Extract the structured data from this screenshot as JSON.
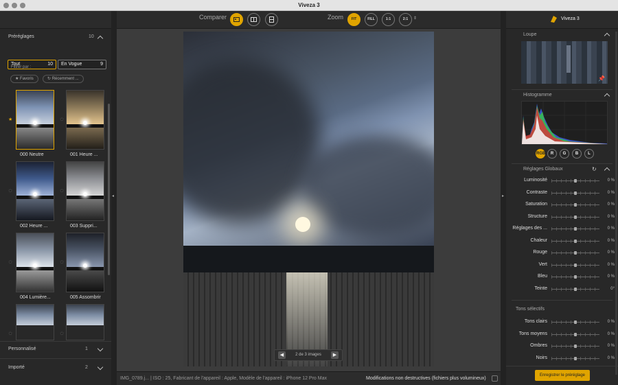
{
  "window": {
    "title": "Viveza 3"
  },
  "left_panel": {
    "presets_title": "Préréglages",
    "presets_count": "10",
    "tabs": [
      {
        "label": "Tout",
        "count": "10"
      },
      {
        "label": "En Vogue",
        "count": "9"
      }
    ],
    "filter_label": "Filtrer par :",
    "filters": [
      "★ Favoris",
      "↻ Récemment ..."
    ],
    "thumbnails": [
      {
        "label": "000 Neutre",
        "favorite": true
      },
      {
        "label": "001 Heure ...",
        "favorite": false
      },
      {
        "label": "002 Heure ...",
        "favorite": false
      },
      {
        "label": "003 Suppri...",
        "favorite": false
      },
      {
        "label": "004 Lumière...",
        "favorite": false
      },
      {
        "label": "005 Assombrir",
        "favorite": false
      },
      {
        "label": "",
        "favorite": false
      },
      {
        "label": "",
        "favorite": false
      }
    ],
    "personalise": {
      "label": "Personnalisé",
      "count": "1"
    },
    "importe": {
      "label": "Importé",
      "count": "2"
    }
  },
  "toolbar": {
    "compare_label": "Comparer",
    "zoom_label": "Zoom",
    "zoom_options": [
      "FIT",
      "FILL",
      "1:1",
      "2:1"
    ],
    "zoom_selected": "FIT"
  },
  "image_nav": {
    "text": "2 de 3 images",
    "prev": "◀",
    "next": "▶"
  },
  "status": {
    "info": "IMG_0789.j...    |    ISO : 25, Fabricant de l'appareil : Apple, Modèle de l'appareil : iPhone 12 Pro Max",
    "nondestructive": "Modifications non destructives (fichiers plus volumineux)"
  },
  "right_panel": {
    "app_name": "Viveza 3",
    "loupe_label": "Loupe",
    "histogram_label": "Histogramme",
    "channels": [
      "RGB",
      "R",
      "G",
      "B",
      "L"
    ],
    "global_label": "Réglages Globaux",
    "global_sliders": [
      {
        "label": "Luminosité",
        "value": "0 %"
      },
      {
        "label": "Contraste",
        "value": "0 %"
      },
      {
        "label": "Saturation",
        "value": "0 %"
      },
      {
        "label": "Structure",
        "value": "0 %"
      },
      {
        "label": "Réglages des ...",
        "value": "0 %"
      },
      {
        "label": "Chaleur",
        "value": "0 %"
      },
      {
        "label": "Rouge",
        "value": "0 %"
      },
      {
        "label": "Vert",
        "value": "0 %"
      },
      {
        "label": "Bleu",
        "value": "0 %"
      },
      {
        "label": "Teinte",
        "value": "0°"
      }
    ],
    "selective_label": "Tons sélectifs",
    "selective_sliders": [
      {
        "label": "Tons clairs",
        "value": "0 %"
      },
      {
        "label": "Tons moyens",
        "value": "0 %"
      },
      {
        "label": "Ombres",
        "value": "0 %"
      },
      {
        "label": "Noirs",
        "value": "0 %"
      }
    ],
    "save_button": "Enregistrer le préréglage"
  },
  "colors": {
    "accent": "#e0a400",
    "panel": "#282828",
    "canvas": "#3c3c3c"
  }
}
